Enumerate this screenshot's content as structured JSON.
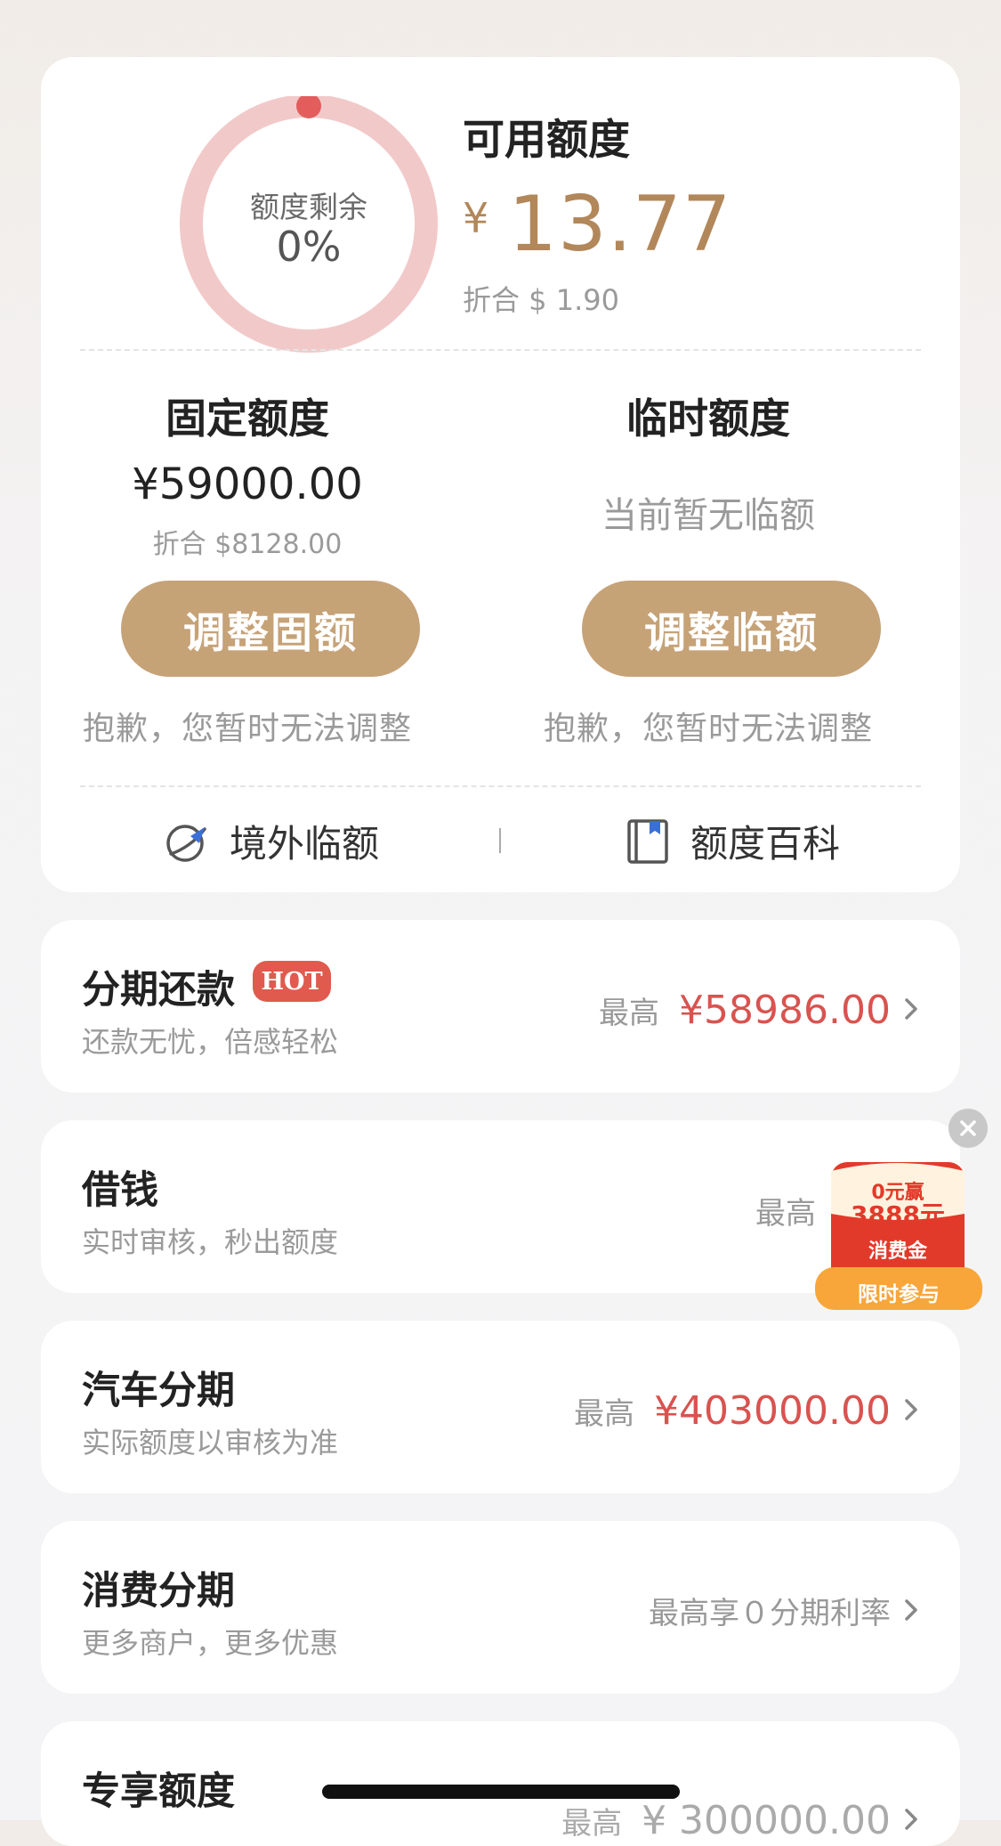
{
  "summary": {
    "ring_label": "额度剩余",
    "ring_percent": "0%",
    "ring_percent_value": 0,
    "available_title": "可用额度",
    "available_currency": "¥",
    "available_amount": "13.77",
    "available_converted": "折合 $ 1.90"
  },
  "fixed": {
    "title": "固定额度",
    "amount": "¥59000.00",
    "converted": "折合 $8128.00",
    "button_label": "调整固额",
    "note": "抱歉，您暂时无法调整"
  },
  "temporary": {
    "title": "临时额度",
    "status": "当前暂无临额",
    "button_label": "调整临额",
    "note": "抱歉，您暂时无法调整"
  },
  "links": {
    "overseas": "境外临额",
    "wiki": "额度百科"
  },
  "rows": [
    {
      "title": "分期还款",
      "badge": "HOT",
      "subtitle": "还款无忧，倍感轻松",
      "prefix": "最高",
      "amount": "¥58986.00"
    },
    {
      "title": "借钱",
      "subtitle": "实时审核，秒出额度",
      "prefix": "最高",
      "amount": "¥"
    },
    {
      "title": "汽车分期",
      "subtitle": "实际额度以审核为准",
      "prefix": "最高",
      "amount": "¥403000.00"
    },
    {
      "title": "消费分期",
      "subtitle": "更多商户，更多优惠",
      "prefix": "最高享０分期利率",
      "amount": ""
    },
    {
      "title": "专享额度",
      "subtitle": "",
      "prefix": "最高",
      "amount": "¥ 300000.00"
    }
  ],
  "promo": {
    "line1": "0元赢",
    "line2": "3888元",
    "line3": "消费金",
    "cta": "限时参与"
  },
  "colors": {
    "gold": "#c6a277",
    "amount_gold": "#b2875a",
    "red": "#d9534f",
    "ring": "#f2c9c9"
  }
}
